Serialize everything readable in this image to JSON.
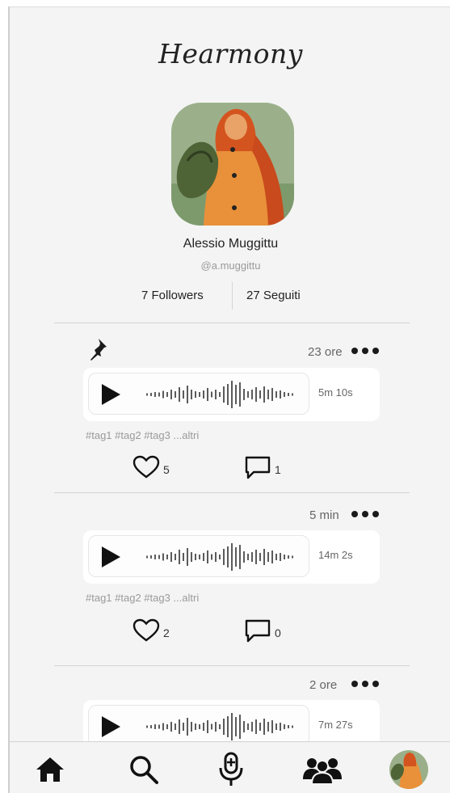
{
  "app": {
    "title": "Hearmony"
  },
  "profile": {
    "name": "Alessio Muggittu",
    "handle": "@a.muggittu",
    "followers_label": "7 Followers",
    "following_label": "27 Seguiti"
  },
  "posts": [
    {
      "pinned": true,
      "time": "23 ore",
      "duration": "5m 10s",
      "tags": "#tag1 #tag2 #tag3  ...altri",
      "likes": "5",
      "comments": "1"
    },
    {
      "pinned": false,
      "time": "5 min",
      "duration": "14m 2s",
      "tags": "#tag1 #tag2 #tag3  ...altri",
      "likes": "2",
      "comments": "0"
    },
    {
      "pinned": false,
      "time": "2 ore",
      "duration": "7m 27s"
    }
  ],
  "icons": {
    "pin": "pushpin-icon",
    "more": "more-dots-icon",
    "play": "play-icon",
    "like": "heart-icon",
    "comment": "comment-icon",
    "home": "home-icon",
    "search": "search-icon",
    "record": "microphone-plus-icon",
    "community": "people-icon"
  },
  "colors": {
    "background": "#f4f4f4",
    "card": "#ffffff",
    "text": "#222222",
    "muted": "#9a9a9a",
    "avatar_orange": "#e8913a"
  }
}
